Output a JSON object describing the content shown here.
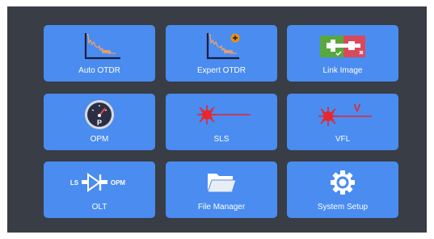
{
  "menu": {
    "tiles": [
      {
        "label": "Auto OTDR",
        "icon": "otdr-trace-icon"
      },
      {
        "label": "Expert OTDR",
        "icon": "otdr-trace-plus-icon"
      },
      {
        "label": "Link Image",
        "icon": "link-image-icon"
      },
      {
        "label": "OPM",
        "icon": "power-meter-gauge-icon",
        "gauge_letter": "P"
      },
      {
        "label": "SLS",
        "icon": "laser-source-icon"
      },
      {
        "label": "VFL",
        "icon": "visual-fault-locator-icon",
        "marker": "V"
      },
      {
        "label": "OLT",
        "icon": "diode-ls-opm-icon",
        "left_text": "LS",
        "right_text": "OPM"
      },
      {
        "label": "File Manager",
        "icon": "folder-icon"
      },
      {
        "label": "System Setup",
        "icon": "gear-icon"
      }
    ]
  },
  "colors": {
    "screen_bg": "#383d46",
    "tile_bg": "#4a8cf0",
    "trace": "#e9a070",
    "laser_red": "#e8262c",
    "icon_dark": "#1a1d3d",
    "plus_orange": "#f0900e",
    "link_green": "#58a83e",
    "link_red": "#d9495c"
  }
}
